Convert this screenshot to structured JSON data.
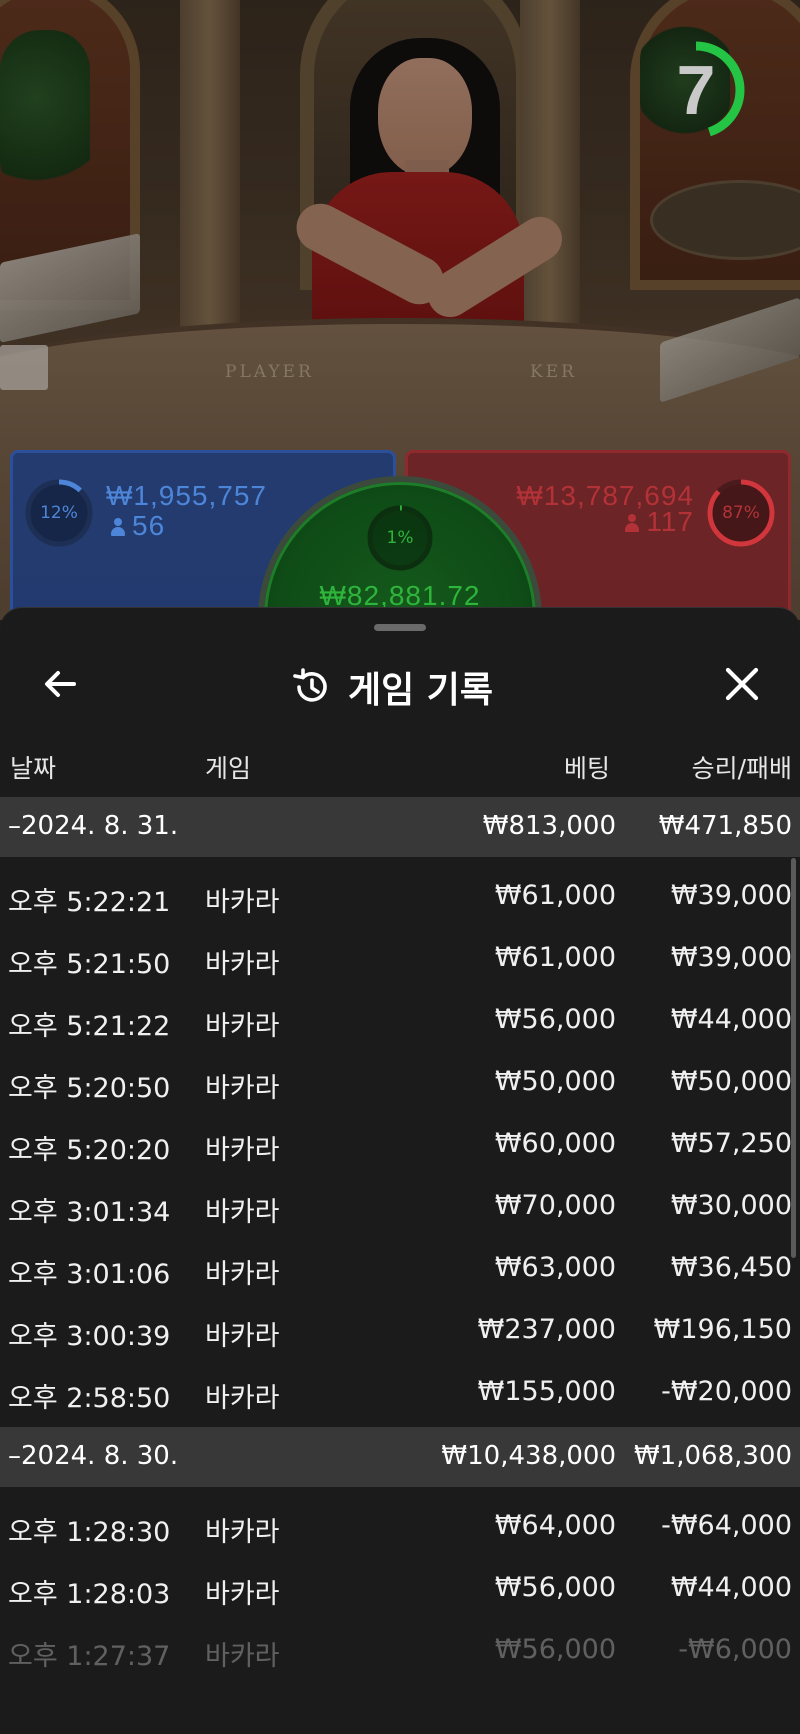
{
  "video": {
    "felt_player_label": "PLAYER",
    "felt_banker_label": "KER",
    "timer_value": "7",
    "timer_fraction": 0.45
  },
  "bets": {
    "player": {
      "percent": "12%",
      "percent_value": 0.12,
      "amount": "₩1,955,757",
      "players": "56",
      "color": "#4d86d8"
    },
    "banker": {
      "percent": "87%",
      "percent_value": 0.87,
      "amount": "₩13,787,694",
      "players": "117",
      "color": "#b33237"
    },
    "tie": {
      "percent": "1%",
      "percent_value": 0.01,
      "amount": "₩82,881.72",
      "color": "#2fb43c"
    }
  },
  "sheet": {
    "title": "게임 기록",
    "icons": {
      "back": "arrow-left-icon",
      "title": "history-icon",
      "close": "close-icon"
    }
  },
  "columns": {
    "date": "날짜",
    "game": "게임",
    "bet": "베팅",
    "result": "승리/패배"
  },
  "groups": [
    {
      "date": "–2024. 8. 31.",
      "bet": "₩813,000",
      "result": "₩471,850",
      "rows": [
        {
          "time": "오후 5:22:21",
          "game": "바카라",
          "bet": "₩61,000",
          "result": "₩39,000"
        },
        {
          "time": "오후 5:21:50",
          "game": "바카라",
          "bet": "₩61,000",
          "result": "₩39,000"
        },
        {
          "time": "오후 5:21:22",
          "game": "바카라",
          "bet": "₩56,000",
          "result": "₩44,000"
        },
        {
          "time": "오후 5:20:50",
          "game": "바카라",
          "bet": "₩50,000",
          "result": "₩50,000"
        },
        {
          "time": "오후 5:20:20",
          "game": "바카라",
          "bet": "₩60,000",
          "result": "₩57,250"
        },
        {
          "time": "오후 3:01:34",
          "game": "바카라",
          "bet": "₩70,000",
          "result": "₩30,000"
        },
        {
          "time": "오후 3:01:06",
          "game": "바카라",
          "bet": "₩63,000",
          "result": "₩36,450"
        },
        {
          "time": "오후 3:00:39",
          "game": "바카라",
          "bet": "₩237,000",
          "result": "₩196,150"
        },
        {
          "time": "오후 2:58:50",
          "game": "바카라",
          "bet": "₩155,000",
          "result": "-₩20,000"
        }
      ]
    },
    {
      "date": "–2024. 8. 30.",
      "bet": "₩10,438,000",
      "result": "₩1,068,300",
      "rows": [
        {
          "time": "오후 1:28:30",
          "game": "바카라",
          "bet": "₩64,000",
          "result": "-₩64,000"
        },
        {
          "time": "오후 1:28:03",
          "game": "바카라",
          "bet": "₩56,000",
          "result": "₩44,000"
        },
        {
          "time": "오후 1:27:37",
          "game": "바카라",
          "bet": "₩56,000",
          "result": "-₩6,000"
        }
      ]
    }
  ]
}
